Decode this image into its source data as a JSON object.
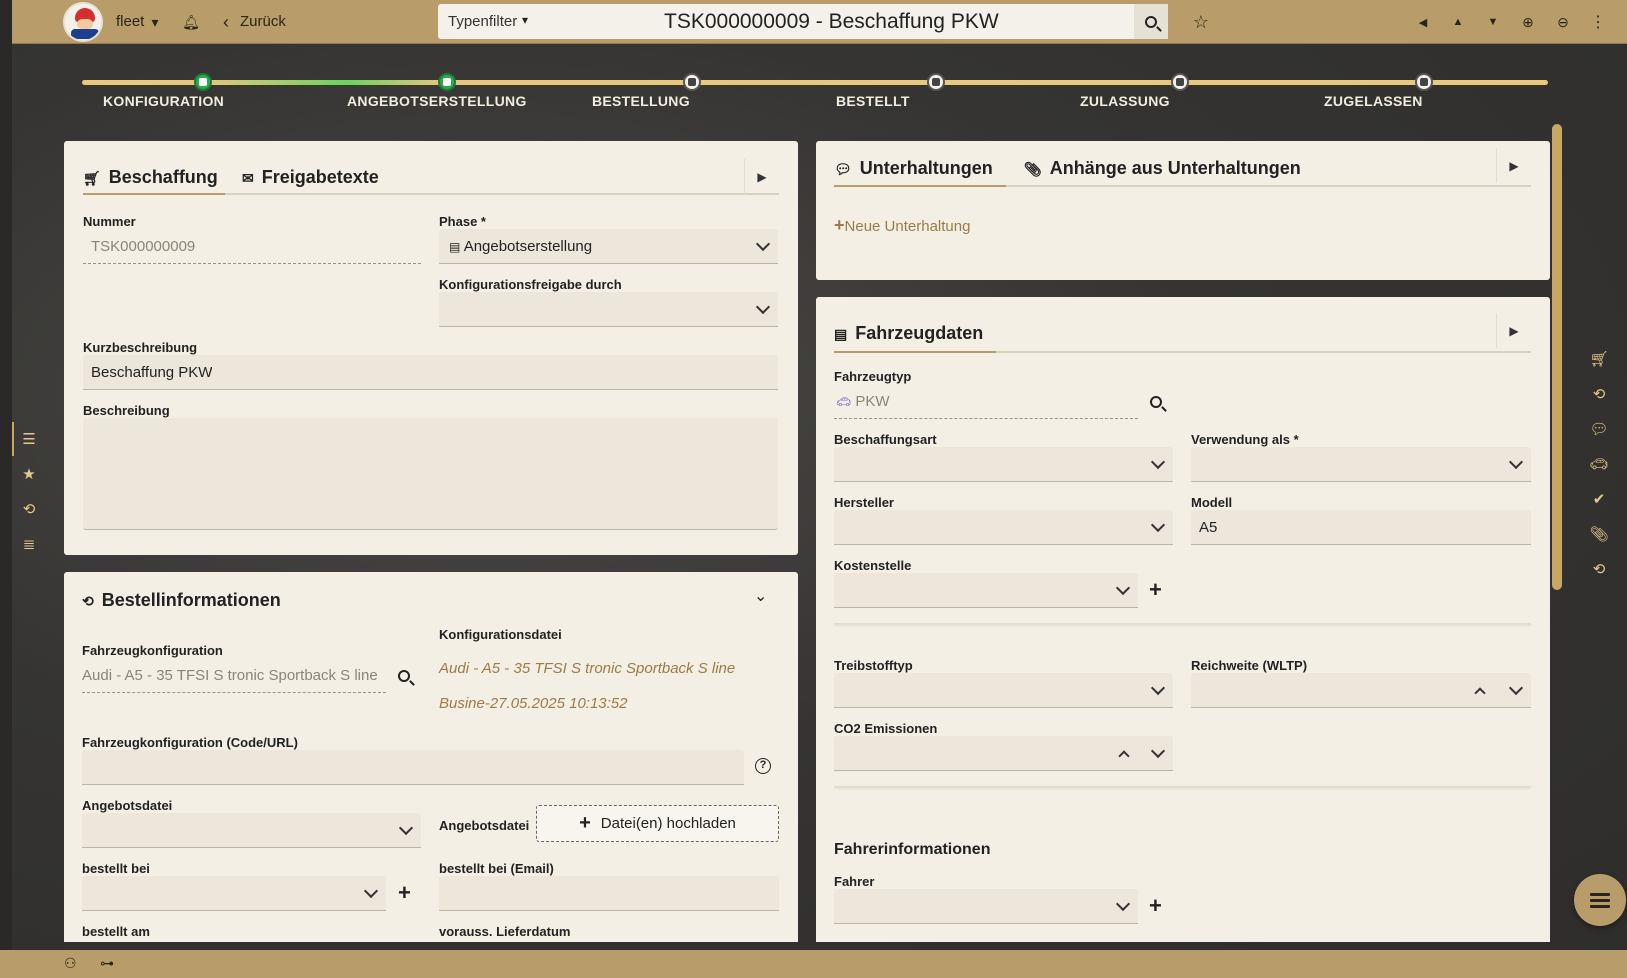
{
  "topbar": {
    "user": "fleet",
    "back_label": "Zurück",
    "type_filter": "Typenfilter",
    "title": "TSK000000009 - Beschaffung PKW"
  },
  "steps": [
    {
      "label": "KONFIGURATION",
      "state": "done"
    },
    {
      "label": "ANGEBOTSERSTELLUNG",
      "state": "current"
    },
    {
      "label": "BESTELLUNG",
      "state": "todo"
    },
    {
      "label": "BESTELLT",
      "state": "todo"
    },
    {
      "label": "ZULASSUNG",
      "state": "todo"
    },
    {
      "label": "ZUGELASSEN",
      "state": "todo"
    }
  ],
  "beschaffung": {
    "tab1": "Beschaffung",
    "tab2": "Freigabetexte",
    "nummer_label": "Nummer",
    "nummer_value": "TSK000000009",
    "phase_label": "Phase *",
    "phase_value": "Angebotserstellung",
    "konfig_label": "Konfigurationsfreigabe durch",
    "kurz_label": "Kurzbeschreibung",
    "kurz_value": "Beschaffung PKW",
    "beschreibung_label": "Beschreibung"
  },
  "bestell": {
    "title": "Bestellinformationen",
    "fk_label": "Fahrzeugkonfiguration",
    "fk_value": "Audi - A5 - 35 TFSI S tronic Sportback S line ...",
    "kd_label": "Konfigurationsdatei",
    "kd_line1": "Audi - A5 - 35 TFSI S tronic Sportback S line",
    "kd_line2": "Busine-27.05.2025 10:13:52",
    "code_label": "Fahrzeugkonfiguration (Code/URL)",
    "angebot_label": "Angebotsdatei",
    "angebot_label2": "Angebotsdatei",
    "upload_label": "Datei(en) hochladen",
    "bestellt_bei_label": "bestellt bei",
    "bestellt_bei_email_label": "bestellt bei (Email)",
    "bestellt_am_label": "bestellt am",
    "lieferdatum_label": "vorauss. Lieferdatum"
  },
  "unterhaltungen": {
    "tab1": "Unterhaltungen",
    "tab2": "Anhänge aus Unterhaltungen",
    "new_label": "Neue Unterhaltung"
  },
  "fahrzeug": {
    "title": "Fahrzeugdaten",
    "typ_label": "Fahrzeugtyp",
    "typ_value": "PKW",
    "beschaffungsart_label": "Beschaffungsart",
    "verwendung_label": "Verwendung als *",
    "hersteller_label": "Hersteller",
    "modell_label": "Modell",
    "modell_value": "A5",
    "kostenstelle_label": "Kostenstelle",
    "treibstoff_label": "Treibstofftyp",
    "reichweite_label": "Reichweite (WLTP)",
    "co2_label": "CO2 Emissionen",
    "fahrerinfo_title": "Fahrerinformationen",
    "fahrer_label": "Fahrer"
  },
  "colors": {
    "accent": "#b89d6a",
    "panel": "#f3efe4",
    "active_step": "#2fa84f"
  }
}
